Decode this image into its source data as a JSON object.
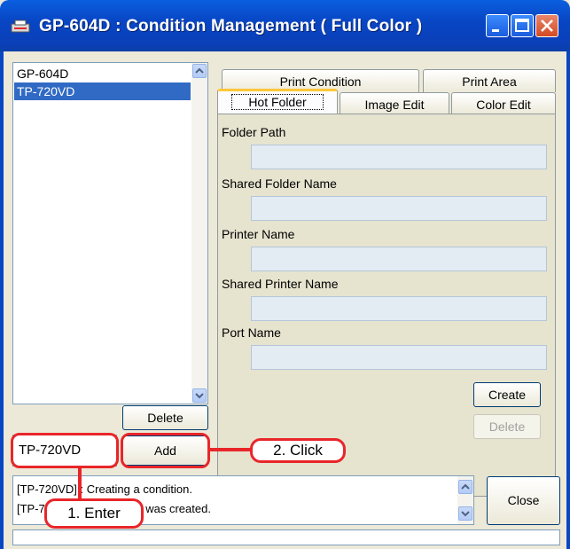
{
  "window": {
    "title": "GP-604D : Condition Management ( Full Color )",
    "controls": [
      "minimize-icon",
      "maximize-icon",
      "close-icon"
    ]
  },
  "condition_list": {
    "items": [
      {
        "label": "GP-604D",
        "selected": false
      },
      {
        "label": "TP-720VD",
        "selected": true
      }
    ]
  },
  "buttons": {
    "delete_left": "Delete",
    "add": "Add",
    "create": "Create",
    "delete_right": "Delete",
    "close": "Close"
  },
  "name_input": {
    "value": "TP-720VD"
  },
  "tabs": {
    "back_row": [
      "Print Condition",
      "Print Area"
    ],
    "front_row": [
      "Hot Folder",
      "Image Edit",
      "Color Edit"
    ],
    "active": "Hot Folder"
  },
  "hot_folder": {
    "fields": [
      {
        "label": "Folder Path",
        "value": ""
      },
      {
        "label": "Shared Folder Name",
        "value": ""
      },
      {
        "label": "Printer Name",
        "value": ""
      },
      {
        "label": "Shared Printer Name",
        "value": ""
      },
      {
        "label": "Port Name",
        "value": ""
      }
    ]
  },
  "messages": {
    "line1": "[TP-720VD] : Creating a condition.",
    "line2": "[TP-720VD] : A condition was created."
  },
  "annotations": {
    "enter": "1. Enter",
    "click": "2. Click"
  },
  "colors": {
    "titlebar": "#0846c4",
    "selection": "#316ac5",
    "annotation": "#e8262a",
    "active_tab_accent": "#ffc83c"
  }
}
